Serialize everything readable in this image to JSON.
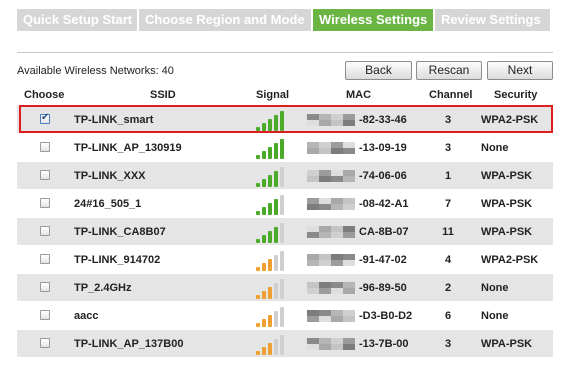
{
  "tabs": [
    {
      "label": "Quick Setup Start",
      "active": false
    },
    {
      "label": "Choose Region and Mode",
      "active": false
    },
    {
      "label": "Wireless Settings",
      "active": true
    },
    {
      "label": "Review Settings",
      "active": false
    }
  ],
  "available_label": "Available Wireless Networks: 40",
  "buttons": {
    "back": "Back",
    "rescan": "Rescan",
    "next": "Next"
  },
  "columns": {
    "choose": "Choose",
    "ssid": "SSID",
    "signal": "Signal",
    "mac": "MAC",
    "channel": "Channel",
    "security": "Security"
  },
  "colors": {
    "active_tab": "#6ab544",
    "inactive_tab": "#d6d6d6",
    "signal_green": "#4caa2b",
    "signal_orange": "#f0a030",
    "signal_empty": "#cfcfcf",
    "selection_border": "#dd1e1e"
  },
  "networks": [
    {
      "checked": true,
      "ssid": "TP-LINK_smart",
      "signal_bars": 5,
      "signal_level": "strong",
      "mac_visible": "-82-33-46",
      "channel": "3",
      "security": "WPA2-PSK"
    },
    {
      "checked": false,
      "ssid": "TP-LINK_AP_130919",
      "signal_bars": 5,
      "signal_level": "strong",
      "mac_visible": "-13-09-19",
      "channel": "3",
      "security": "None"
    },
    {
      "checked": false,
      "ssid": "TP-LINK_XXX",
      "signal_bars": 4,
      "signal_level": "strong",
      "mac_visible": "-74-06-06",
      "channel": "1",
      "security": "WPA-PSK"
    },
    {
      "checked": false,
      "ssid": "24#16_505_1",
      "signal_bars": 4,
      "signal_level": "strong",
      "mac_visible": "-08-42-A1",
      "channel": "7",
      "security": "WPA-PSK"
    },
    {
      "checked": false,
      "ssid": "TP-LINK_CA8B07",
      "signal_bars": 4,
      "signal_level": "strong",
      "mac_visible": "CA-8B-07",
      "channel": "11",
      "security": "WPA-PSK"
    },
    {
      "checked": false,
      "ssid": "TP-LINK_914702",
      "signal_bars": 3,
      "signal_level": "medium",
      "mac_visible": "-91-47-02",
      "channel": "4",
      "security": "WPA2-PSK"
    },
    {
      "checked": false,
      "ssid": "TP_2.4GHz",
      "signal_bars": 3,
      "signal_level": "medium",
      "mac_visible": "-96-89-50",
      "channel": "2",
      "security": "None"
    },
    {
      "checked": false,
      "ssid": "aacc",
      "signal_bars": 3,
      "signal_level": "medium",
      "mac_visible": "-D3-B0-D2",
      "channel": "6",
      "security": "None"
    },
    {
      "checked": false,
      "ssid": "TP-LINK_AP_137B00",
      "signal_bars": 3,
      "signal_level": "medium",
      "mac_visible": "-13-7B-00",
      "channel": "3",
      "security": "WPA-PSK"
    }
  ]
}
